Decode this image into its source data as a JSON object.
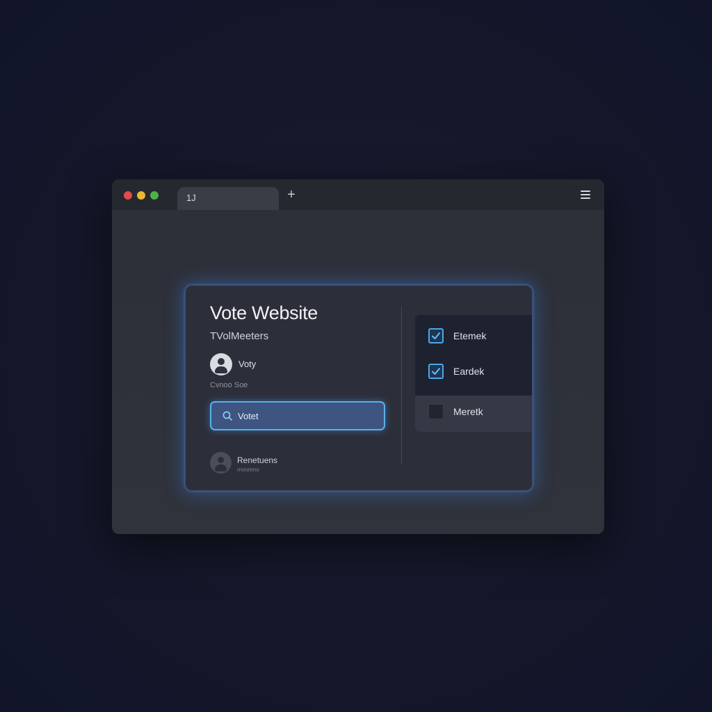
{
  "browser": {
    "tab_label": "1J",
    "new_tab_glyph": "+",
    "menu_icon": "hamburger-menu-icon"
  },
  "card": {
    "title": "Vote Website",
    "subtitle": "TVolMeeters",
    "user_name": "Voty",
    "user_meta": "Cvnoo Soe",
    "vote_button_label": "Votet",
    "footer_name": "Renetuens",
    "footer_sub": "rnoomno"
  },
  "options": [
    {
      "label": "Etemek",
      "checked": true
    },
    {
      "label": "Eardek",
      "checked": true
    },
    {
      "label": "Meretk",
      "checked": false
    }
  ],
  "colors": {
    "accent": "#4aa8e8",
    "glow": "#408cff",
    "background": "#141729"
  }
}
